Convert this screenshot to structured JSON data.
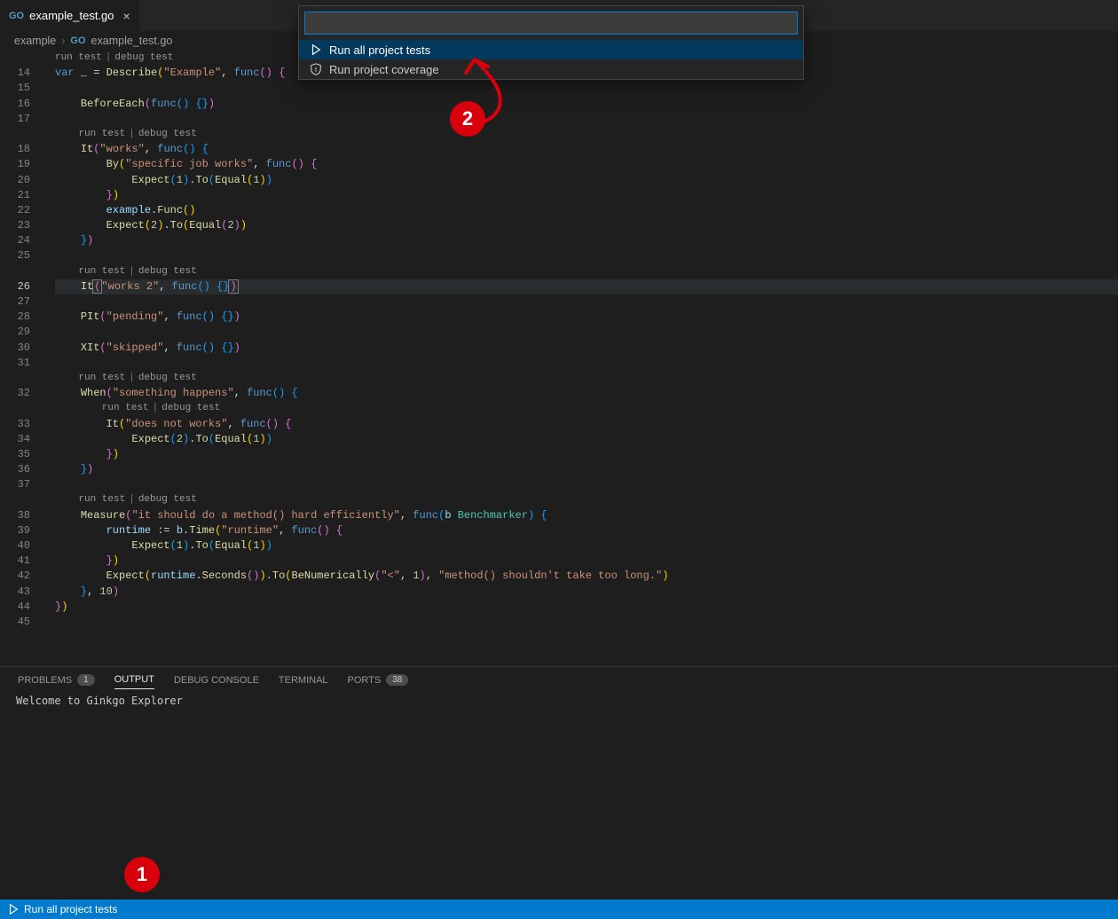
{
  "tab": {
    "filename": "example_test.go"
  },
  "breadcrumb": {
    "folder": "example",
    "file": "example_test.go"
  },
  "codelens": {
    "run": "run test",
    "debug": "debug test"
  },
  "lines": {
    "start": 14,
    "end": 45,
    "current": 26
  },
  "code": {
    "l14_var": "var",
    "l14_us": " _ ",
    "l14_eq": "= ",
    "l14_desc": "Describe",
    "l14_s": "\"Example\"",
    "l14_func": "func",
    "l16_be": "BeforeEach",
    "l16_func": "func",
    "l18_it": "It",
    "l18_s": "\"works\"",
    "l18_func": "func",
    "l19_by": "By",
    "l19_s": "\"specific job works\"",
    "l19_func": "func",
    "l20_exp": "Expect",
    "l20_n1": "1",
    "l20_to": "To",
    "l20_eq": "Equal",
    "l20_n2": "1",
    "l22_ex": "example",
    "l22_fn": "Func",
    "l23_exp": "Expect",
    "l23_n1": "2",
    "l23_to": "To",
    "l23_eq": "Equal",
    "l23_n2": "2",
    "l26_it": "It",
    "l26_s": "\"works 2\"",
    "l26_func": "func",
    "l28_pit": "PIt",
    "l28_s": "\"pending\"",
    "l28_func": "func",
    "l30_xit": "XIt",
    "l30_s": "\"skipped\"",
    "l30_func": "func",
    "l32_when": "When",
    "l32_s": "\"something happens\"",
    "l32_func": "func",
    "l33_it": "It",
    "l33_s": "\"does not works\"",
    "l33_func": "func",
    "l34_exp": "Expect",
    "l34_n1": "2",
    "l34_to": "To",
    "l34_eq": "Equal",
    "l34_n2": "1",
    "l38_m": "Measure",
    "l38_s": "\"it should do a method() hard efficiently\"",
    "l38_func": "func",
    "l38_b": "b",
    "l38_bm": "Benchmarker",
    "l39_rt": "runtime",
    "l39_asn": " := ",
    "l39_b": "b",
    "l39_time": "Time",
    "l39_s": "\"runtime\"",
    "l39_func": "func",
    "l40_exp": "Expect",
    "l40_n1": "1",
    "l40_to": "To",
    "l40_eq": "Equal",
    "l40_n2": "1",
    "l42_exp": "Expect",
    "l42_rt": "runtime",
    "l42_sec": "Seconds",
    "l42_to": "To",
    "l42_bn": "BeNumerically",
    "l42_s1": "\"<\"",
    "l42_n": "1",
    "l42_s2": "\"method() shouldn't take too long.\"",
    "l43_n": "10"
  },
  "panel": {
    "tabs": {
      "problems": "PROBLEMS",
      "problems_count": "1",
      "output": "OUTPUT",
      "debug": "DEBUG CONSOLE",
      "terminal": "TERMINAL",
      "ports": "PORTS",
      "ports_count": "38"
    },
    "output_text": "Welcome to Ginkgo Explorer"
  },
  "status": {
    "run_all": "Run all project tests"
  },
  "quickinput": {
    "items": [
      {
        "label": "Run all project tests",
        "selected": true,
        "icon": "play"
      },
      {
        "label": "Run project coverage",
        "selected": false,
        "icon": "shield"
      }
    ]
  },
  "annotations": {
    "one": "1",
    "two": "2"
  }
}
